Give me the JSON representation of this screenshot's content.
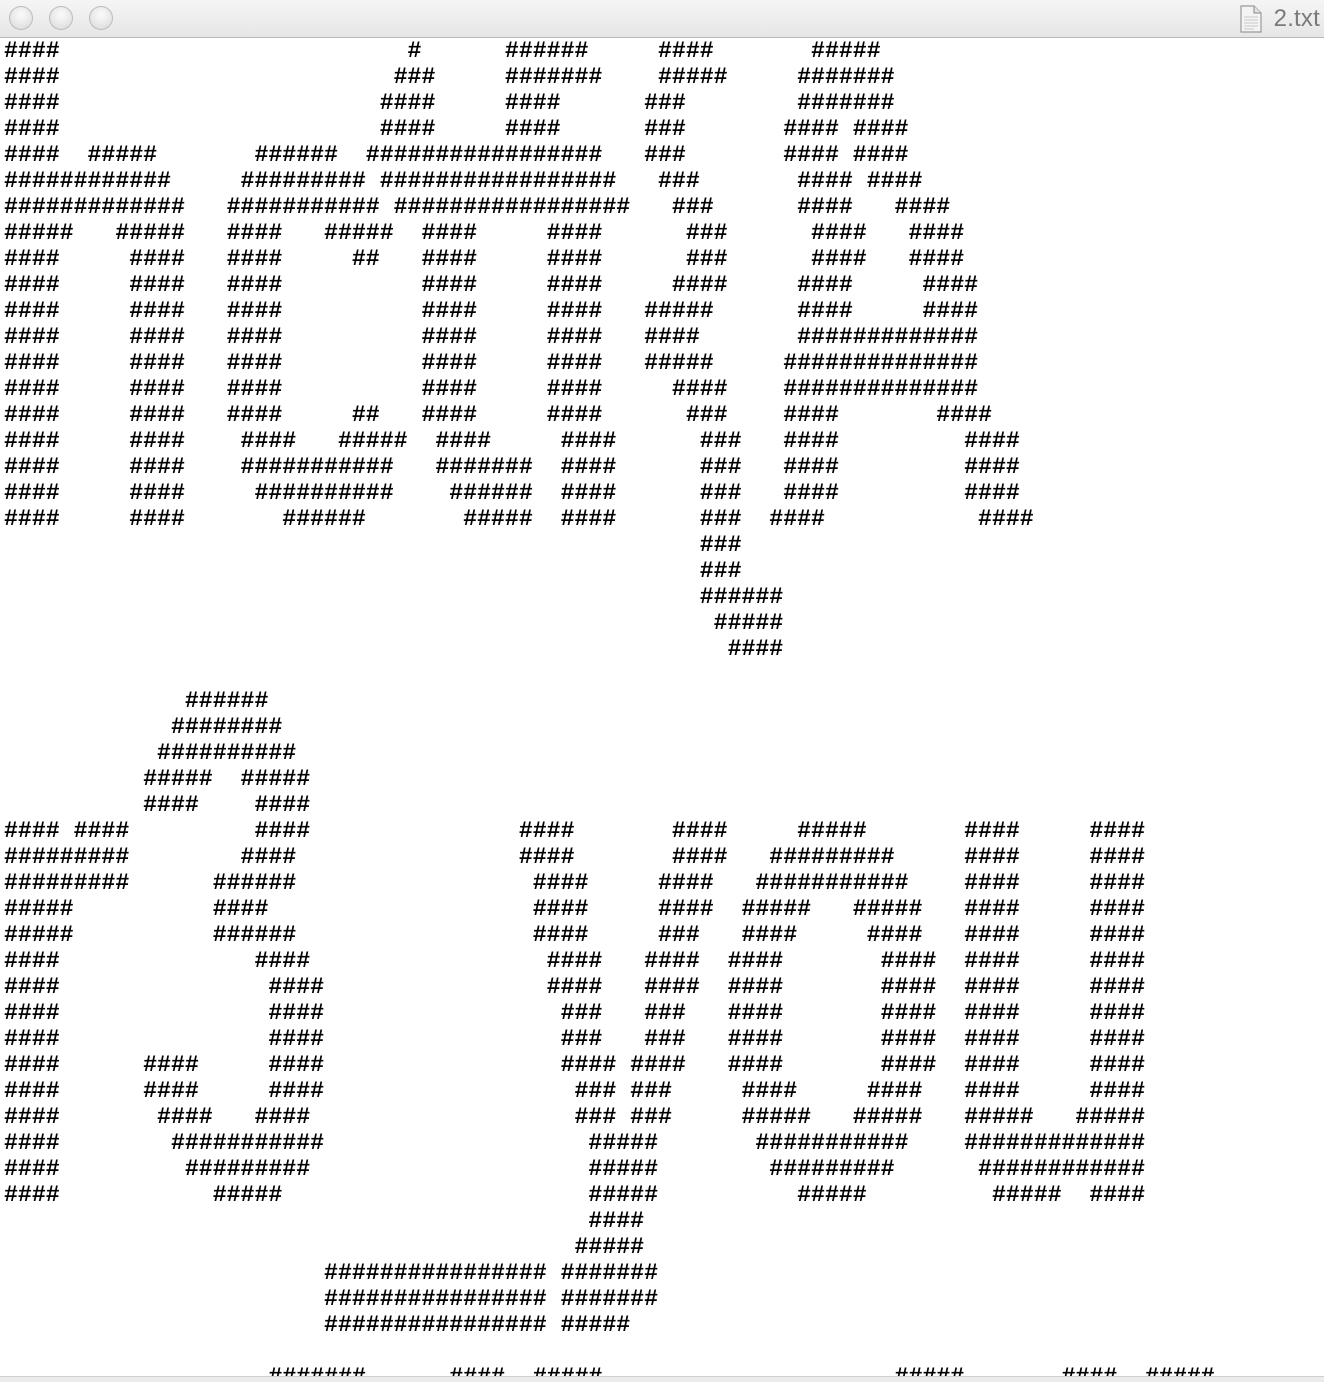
{
  "window": {
    "title": "2.txt",
    "file_icon": "document-icon",
    "buttons": [
      "close",
      "minimize",
      "zoom"
    ]
  },
  "document": {
    "text": "####                         #      ######     ####       #####\n####                        ###     #######    #####     #######\n####                       ####     ####      ###        #######\n####                       ####     ####      ###       #### ####\n####  #####       ######  #################   ###       #### ####\n############     ######### #################   ###       #### ####\n#############   ########### #################   ###      ####   ####\n#####   #####   ####   #####  ####     ####      ###      ####   ####\n####     ####   ####     ##   ####     ####      ###      ####   ####\n####     ####   ####          ####     ####     ####     ####     ####\n####     ####   ####          ####     ####   #####      ####     ####\n####     ####   ####          ####     ####   ####       #############\n####     ####   ####          ####     ####   #####     ##############\n####     ####   ####          ####     ####     ####    ##############\n####     ####   ####     ##   ####     ####      ###    ####       ####\n####     ####    ####   #####  ####     ####      ###   ####         ####\n####     ####    ###########   #######  ####      ###   ####         ####\n####     ####     ##########    ######  ####      ###   ####         ####\n####     ####       ######       #####  ####      ###  ####           ####\n                                                  ###\n                                                  ###\n                                                  ######\n                                                   #####\n                                                    ####\n\n             ######\n            ########\n           ##########\n          #####  #####\n          ####    ####\n#### ####         ####               ####       ####     #####       ####     ####\n#########        ####                ####       ####   #########     ####     ####\n#########      ######                 ####     ####   ###########    ####     ####\n#####          ####                   ####     ####  #####   #####   ####     ####\n#####          ######                 ####     ###   ####     ####   ####     ####\n####              ####                 ####   ####  ####       ####  ####     ####\n####               ####                ####   ####  ####       ####  ####     ####\n####               ####                 ###   ###   ####       ####  ####     ####\n####               ####                 ###   ###   ####       ####  ####     ####\n####      ####     ####                 #### ####   ####       ####  ####     ####\n####      ####     ####                  ### ###     ####     ####   ####     ####\n####       ####   ####                   ### ###     #####   #####   #####   #####\n####        ###########                   #####       ###########    #############\n####         #########                    #####        #########      ############\n####           #####                      #####          #####         #####  ####\n                                          ####\n                                         #####\n                       ################ #######\n                       ################ #######\n                       ################ #####\n\n                   #######      ####  #####                     #####       ####  #####\n                  #########     #### #######                  #########   ###########"
  }
}
